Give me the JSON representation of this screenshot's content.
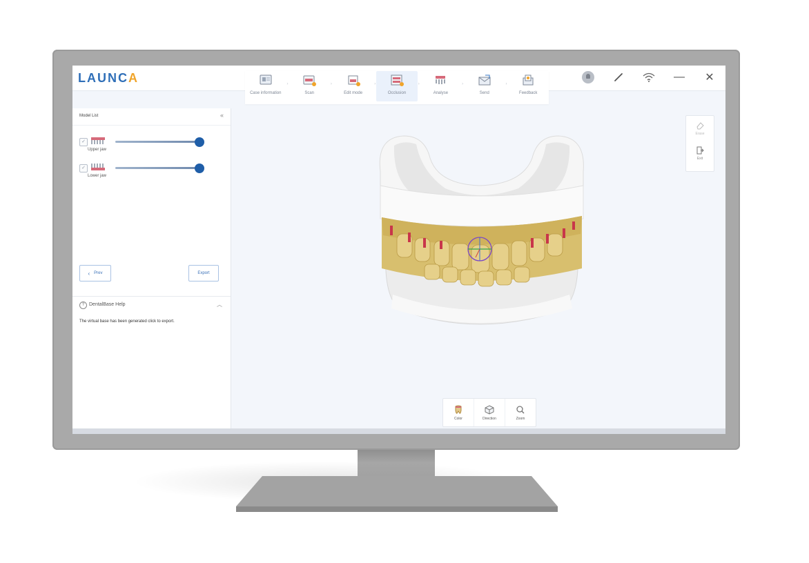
{
  "app": {
    "logo_main": "LAUNC",
    "logo_accent": "A"
  },
  "steps": [
    {
      "label": "Case information",
      "icon": "case-info-icon"
    },
    {
      "label": "Scan",
      "icon": "scan-icon"
    },
    {
      "label": "Edit mode",
      "icon": "edit-model-icon"
    },
    {
      "label": "Occlusion",
      "icon": "occlusion-icon"
    },
    {
      "label": "Analyse",
      "icon": "analyse-icon"
    },
    {
      "label": "Send",
      "icon": "send-icon"
    },
    {
      "label": "Feedback",
      "icon": "feedback-icon"
    }
  ],
  "active_step": "Occlusion",
  "window_controls": {
    "minimize": "—",
    "close": "✕"
  },
  "model_list": {
    "title": "Model List",
    "collapse": "«",
    "items": [
      {
        "label": "Upper jaw",
        "checked": true,
        "opacity_percent": 100
      },
      {
        "label": "Lower jaw",
        "checked": true,
        "opacity_percent": 100
      }
    ],
    "check_glyph": "✓"
  },
  "buttons": {
    "prev": "Prev",
    "prev_chevron": "‹",
    "export": "Export"
  },
  "help": {
    "icon_glyph": "?",
    "title": "DentalBase Help",
    "toggle": "︿",
    "text": "The virtual base has been generated click to export."
  },
  "right_tools": [
    {
      "label": "Erase",
      "enabled": false
    },
    {
      "label": "Exit",
      "enabled": true
    }
  ],
  "bottom_tools": [
    {
      "label": "Color"
    },
    {
      "label": "Direction"
    },
    {
      "label": "Zoom"
    }
  ],
  "colors": {
    "brand_blue": "#2f6fb8",
    "brand_orange": "#f0a42a",
    "slider_thumb": "#1f5ea8",
    "teeth": "#d8bf6e",
    "base": "#f4f4f4"
  }
}
